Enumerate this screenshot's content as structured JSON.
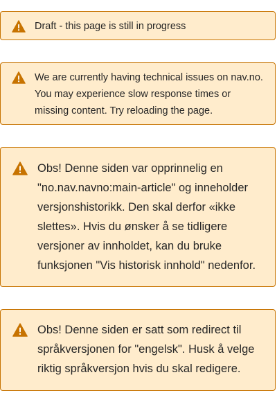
{
  "colors": {
    "alert_background": "#ffeccc",
    "alert_border": "#c77300",
    "warning_icon": "#c77300",
    "text": "#262626"
  },
  "alerts": [
    {
      "icon": "warning-triangle-icon",
      "text": "Draft - this page is still in progress"
    },
    {
      "icon": "warning-triangle-icon",
      "text": "We are currently having technical issues on nav.no. You may experience slow response times or missing content. Try reloading the page."
    },
    {
      "icon": "warning-triangle-icon",
      "text": "Obs! Denne siden var opprinnelig en \"no.nav.navno:main-article\" og inneholder versjonshistorikk. Den skal derfor «ikke slettes». Hvis du ønsker å se tidligere versjoner av innholdet, kan du bruke funksjonen \"Vis historisk innhold\" nedenfor."
    },
    {
      "icon": "warning-triangle-icon",
      "text": "Obs! Denne siden er satt som redirect til språkversjonen for \"engelsk\". Husk å velge riktig språkversjon hvis du skal redigere."
    }
  ]
}
